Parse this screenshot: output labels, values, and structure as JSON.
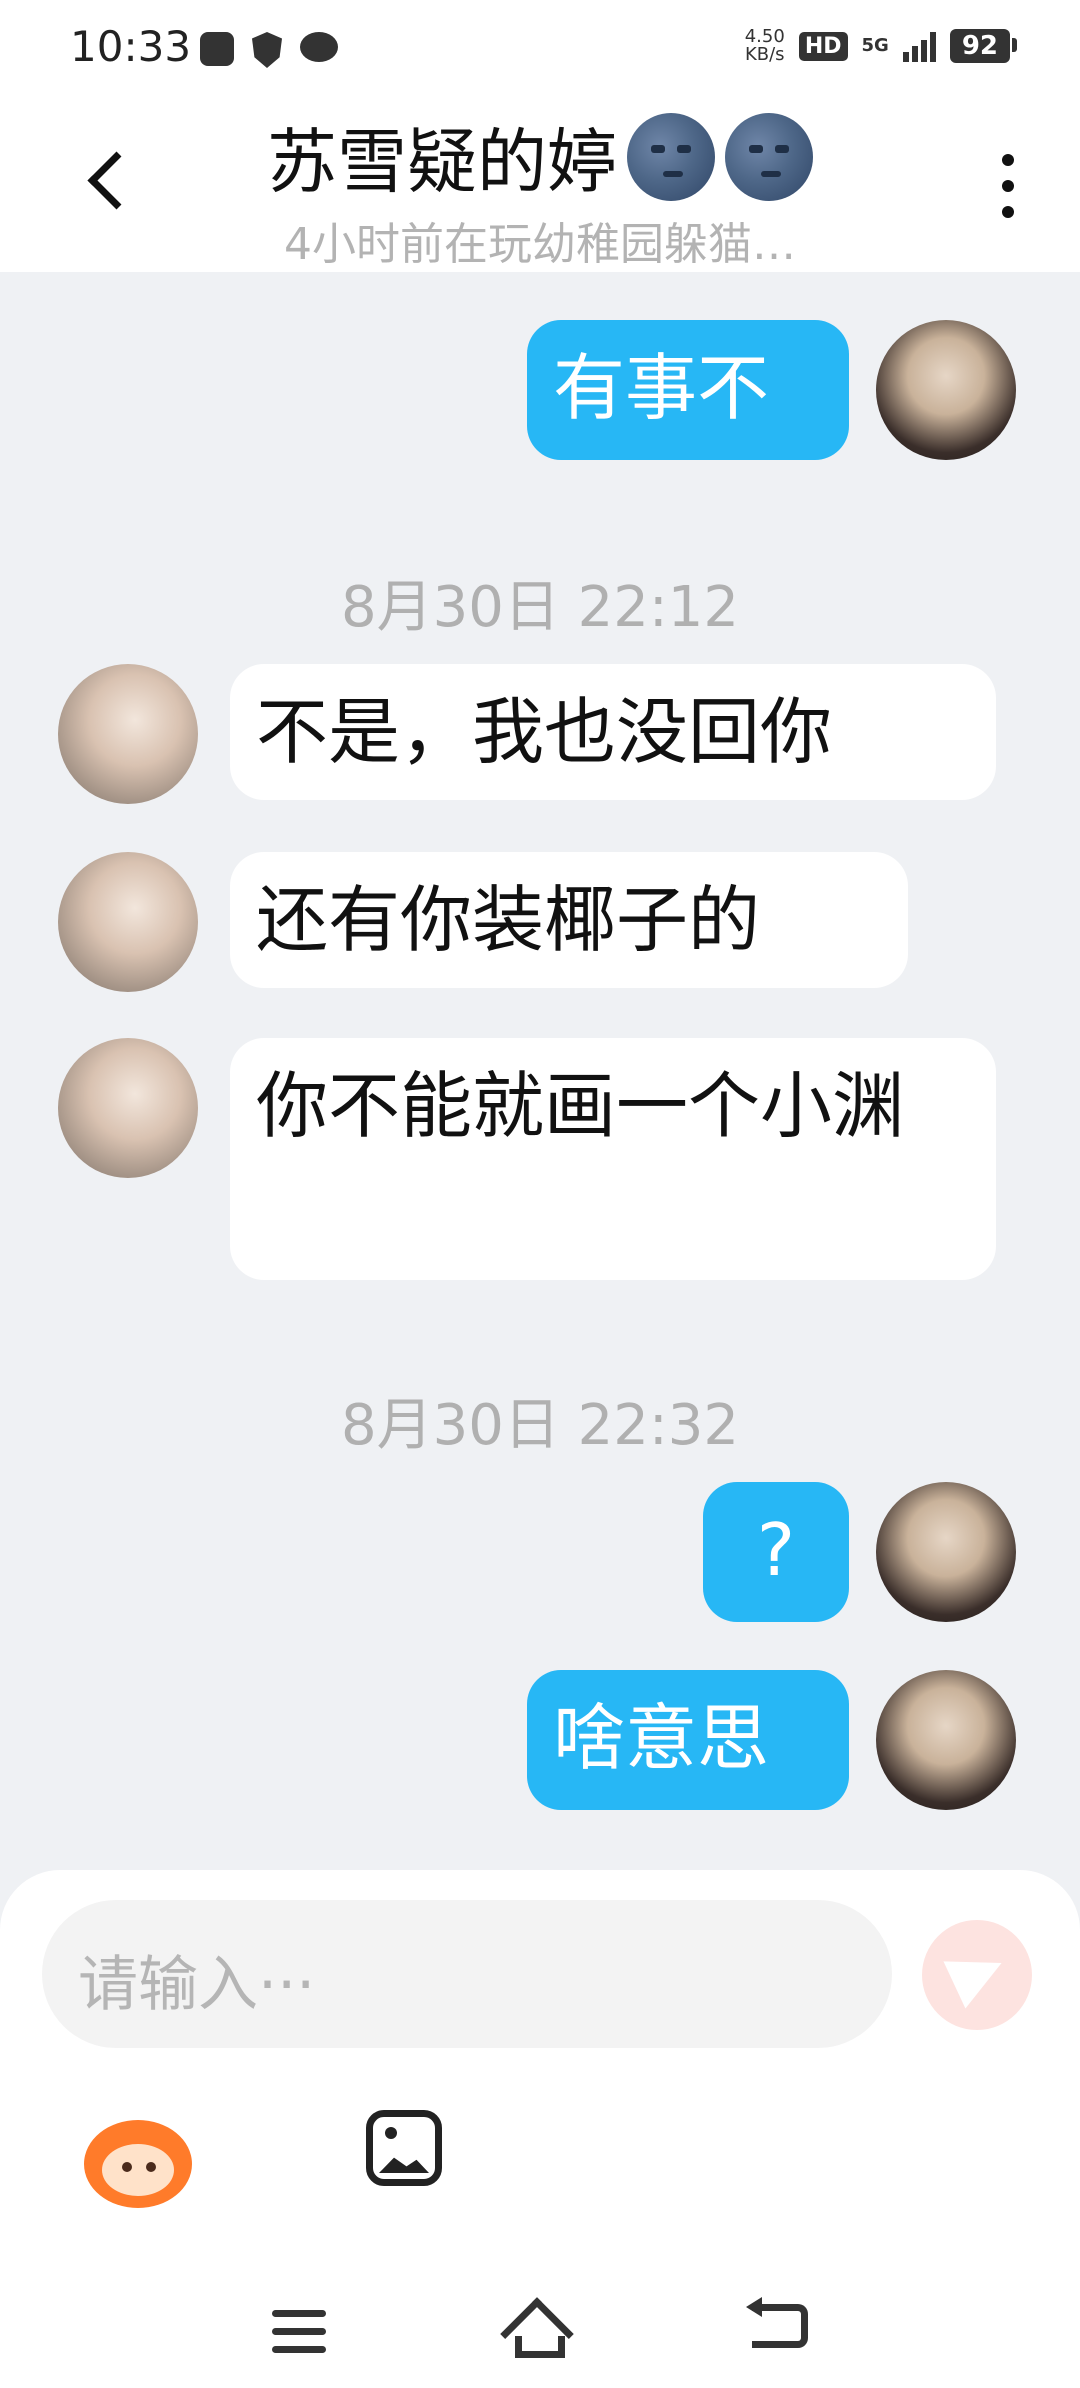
{
  "status_bar": {
    "time": "10:33",
    "speed_value": "4.50",
    "speed_unit": "KB/s",
    "hd": "HD",
    "network": "5G",
    "battery": "92"
  },
  "header": {
    "title": "苏雪疑的婷",
    "subtitle": "4小时前在玩幼稚园躲猫…",
    "title_emoji": "moon-face"
  },
  "messages": [
    {
      "side": "me",
      "text": "有事不"
    },
    {
      "timestamp": "8月30日 22:12"
    },
    {
      "side": "them",
      "text": "不是，我也没回你"
    },
    {
      "side": "them",
      "text": "还有你装椰子的"
    },
    {
      "side": "them",
      "text": "你不能就画一个小渊"
    },
    {
      "timestamp": "8月30日 22:32"
    },
    {
      "side": "me",
      "text": "?"
    },
    {
      "side": "me",
      "text": "啥意思"
    }
  ],
  "composer": {
    "placeholder": "请输入···"
  },
  "colors": {
    "outgoing_bubble": "#27b7f5",
    "incoming_bubble": "#ffffff",
    "background": "#eff1f4",
    "send_button": "#fde3e0"
  }
}
